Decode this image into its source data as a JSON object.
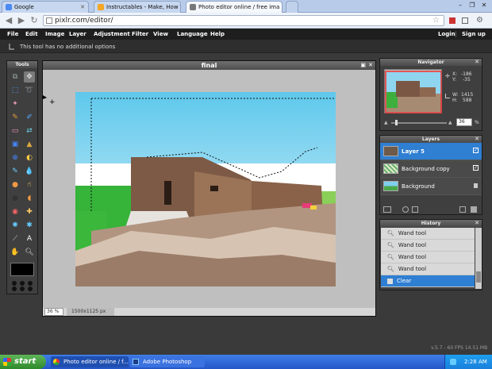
{
  "browser": {
    "tabs": [
      {
        "title": "Google"
      },
      {
        "title": "Instructables - Make, How To"
      },
      {
        "title": "Photo editor online / free ima"
      }
    ],
    "url": "pixlr.com/editor/"
  },
  "menu": {
    "items": [
      "File",
      "Edit",
      "Image",
      "Layer",
      "Adjustment",
      "Filter",
      "View",
      "Language",
      "Help"
    ],
    "login": "Login",
    "signup": "Sign up"
  },
  "options": {
    "message": "This tool has no additional options"
  },
  "tools": {
    "title": "Tools"
  },
  "document": {
    "title": "final",
    "zoom": "36",
    "zoom_unit": "%",
    "size": "1500x1125 px"
  },
  "navigator": {
    "title": "Navigator",
    "x_label": "X:",
    "x_value": "-186",
    "y_label": "Y:",
    "y_value": "-35",
    "w_label": "W:",
    "w_value": "1415",
    "h_label": "H:",
    "h_value": "588",
    "zoom": "36",
    "zoom_unit": "%"
  },
  "layers": {
    "title": "Layers",
    "items": [
      {
        "name": "Layer 5",
        "selected": true
      },
      {
        "name": "Background copy",
        "selected": false
      },
      {
        "name": "Background",
        "selected": false
      }
    ]
  },
  "history": {
    "title": "History",
    "items": [
      {
        "label": "Wand tool"
      },
      {
        "label": "Wand tool"
      },
      {
        "label": "Wand tool"
      },
      {
        "label": "Wand tool"
      },
      {
        "label": "Clear"
      }
    ]
  },
  "status": {
    "fps": "v.5.7 - 60 FPS 14.51 MB"
  },
  "taskbar": {
    "start": "start",
    "items": [
      "Photo editor online / f...",
      "Adobe Photoshop"
    ],
    "clock": "2:28 AM"
  },
  "colors": {
    "accent": "#2f7fd2",
    "selection": "#2f7fd2",
    "foreground_swatch": "#000000"
  }
}
